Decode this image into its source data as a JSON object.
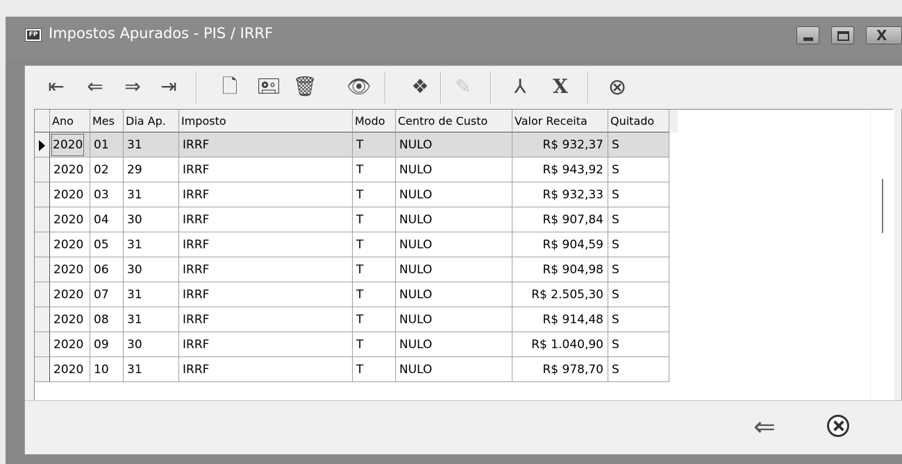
{
  "window": {
    "title": "Impostos Apurados - PIS / IRRF",
    "app_icon_text": "FP"
  },
  "toolbar": {
    "buttons": [
      {
        "name": "first-record-icon",
        "glyph": "⇤"
      },
      {
        "name": "prev-record-icon",
        "glyph": "⇐"
      },
      {
        "name": "next-record-icon",
        "glyph": "⇒"
      },
      {
        "name": "last-record-icon",
        "glyph": "⇥"
      },
      {
        "name": "new-document-icon",
        "glyph": "🗋"
      },
      {
        "name": "edit-record-icon",
        "glyph": "🖭"
      },
      {
        "name": "trash-icon",
        "glyph": "🗑"
      },
      {
        "name": "eye-icon",
        "glyph": "👁"
      },
      {
        "name": "wings-icon",
        "glyph": "❖"
      },
      {
        "name": "notes-disabled-icon",
        "glyph": "✎"
      },
      {
        "name": "pdf-icon",
        "glyph": "⅄"
      },
      {
        "name": "excel-icon",
        "glyph": "X"
      },
      {
        "name": "close-circle-icon",
        "glyph": "⊗"
      }
    ]
  },
  "table": {
    "columns": [
      "Ano",
      "Mes",
      "Dia Ap.",
      "Imposto",
      "Modo",
      "Centro de Custo",
      "Valor Receita",
      "Quitado"
    ],
    "rows": [
      [
        "2020",
        "01",
        "31",
        "IRRF",
        "T",
        "NULO",
        "R$ 932,37",
        "S"
      ],
      [
        "2020",
        "02",
        "29",
        "IRRF",
        "T",
        "NULO",
        "R$ 943,92",
        "S"
      ],
      [
        "2020",
        "03",
        "31",
        "IRRF",
        "T",
        "NULO",
        "R$ 932,33",
        "S"
      ],
      [
        "2020",
        "04",
        "30",
        "IRRF",
        "T",
        "NULO",
        "R$ 907,84",
        "S"
      ],
      [
        "2020",
        "05",
        "31",
        "IRRF",
        "T",
        "NULO",
        "R$ 904,59",
        "S"
      ],
      [
        "2020",
        "06",
        "30",
        "IRRF",
        "T",
        "NULO",
        "R$ 904,98",
        "S"
      ],
      [
        "2020",
        "07",
        "31",
        "IRRF",
        "T",
        "NULO",
        "R$ 2.505,30",
        "S"
      ],
      [
        "2020",
        "08",
        "31",
        "IRRF",
        "T",
        "NULO",
        "R$ 914,48",
        "S"
      ],
      [
        "2020",
        "09",
        "30",
        "IRRF",
        "T",
        "NULO",
        "R$ 1.040,90",
        "S"
      ],
      [
        "2020",
        "10",
        "31",
        "IRRF",
        "T",
        "NULO",
        "R$ 978,70",
        "S"
      ]
    ],
    "selected_row": 0
  },
  "footer": {
    "back_glyph": "⇐"
  },
  "colors": {
    "titlebar": "#8a8a8a",
    "window_border": "#888888",
    "client_bg": "#f0f0f0",
    "selected_row": "#dcdcdc"
  }
}
